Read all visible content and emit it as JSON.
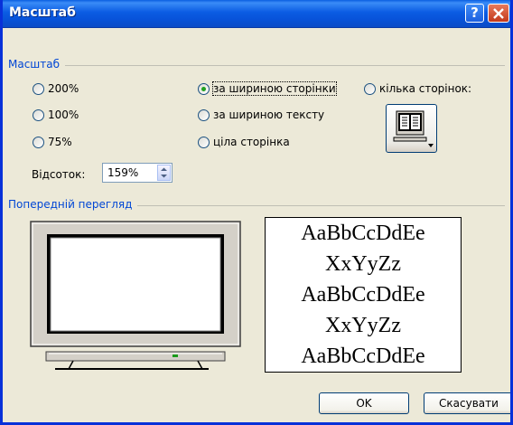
{
  "window": {
    "title": "Масштаб",
    "help_label": "?"
  },
  "zoom_group": {
    "label": "Масштаб",
    "presets": [
      {
        "label": "200%",
        "checked": false
      },
      {
        "label": "100%",
        "checked": false
      },
      {
        "label": "75%",
        "checked": false
      }
    ],
    "fit_options": [
      {
        "label": "за шириною сторінки",
        "checked": true
      },
      {
        "label": "за шириною тексту",
        "checked": false
      },
      {
        "label": "ціла сторінка",
        "checked": false
      }
    ],
    "many_pages": {
      "label": "кілька сторінок:",
      "checked": false
    },
    "percent": {
      "label": "Відсоток:",
      "value": "159%"
    }
  },
  "preview_group": {
    "label": "Попередній перегляд",
    "sample_lines": [
      "AaBbCcDdEe",
      "XxYyZz",
      "AaBbCcDdEe",
      "XxYyZz",
      "AaBbCcDdEe"
    ]
  },
  "buttons": {
    "ok": "OK",
    "cancel": "Скасувати"
  }
}
